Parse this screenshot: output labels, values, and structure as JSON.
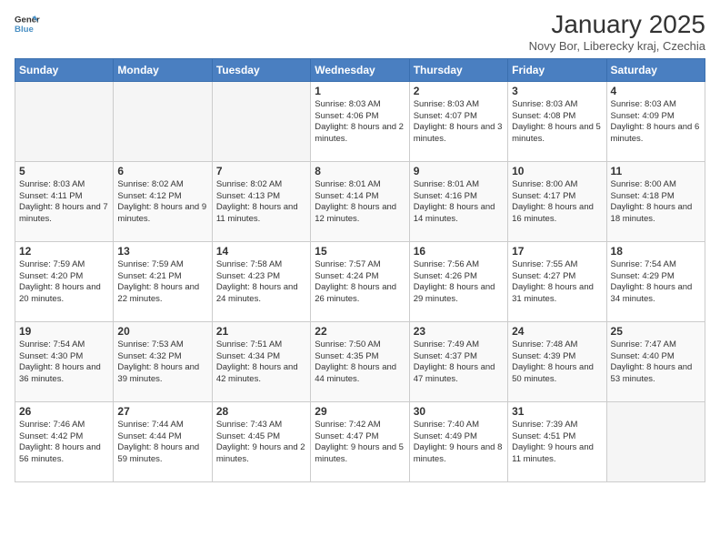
{
  "logo": {
    "line1": "General",
    "line2": "Blue"
  },
  "title": "January 2025",
  "location": "Novy Bor, Liberecky kraj, Czechia",
  "weekdays": [
    "Sunday",
    "Monday",
    "Tuesday",
    "Wednesday",
    "Thursday",
    "Friday",
    "Saturday"
  ],
  "weeks": [
    [
      {
        "day": "",
        "info": ""
      },
      {
        "day": "",
        "info": ""
      },
      {
        "day": "",
        "info": ""
      },
      {
        "day": "1",
        "info": "Sunrise: 8:03 AM\nSunset: 4:06 PM\nDaylight: 8 hours and 2 minutes."
      },
      {
        "day": "2",
        "info": "Sunrise: 8:03 AM\nSunset: 4:07 PM\nDaylight: 8 hours and 3 minutes."
      },
      {
        "day": "3",
        "info": "Sunrise: 8:03 AM\nSunset: 4:08 PM\nDaylight: 8 hours and 5 minutes."
      },
      {
        "day": "4",
        "info": "Sunrise: 8:03 AM\nSunset: 4:09 PM\nDaylight: 8 hours and 6 minutes."
      }
    ],
    [
      {
        "day": "5",
        "info": "Sunrise: 8:03 AM\nSunset: 4:11 PM\nDaylight: 8 hours and 7 minutes."
      },
      {
        "day": "6",
        "info": "Sunrise: 8:02 AM\nSunset: 4:12 PM\nDaylight: 8 hours and 9 minutes."
      },
      {
        "day": "7",
        "info": "Sunrise: 8:02 AM\nSunset: 4:13 PM\nDaylight: 8 hours and 11 minutes."
      },
      {
        "day": "8",
        "info": "Sunrise: 8:01 AM\nSunset: 4:14 PM\nDaylight: 8 hours and 12 minutes."
      },
      {
        "day": "9",
        "info": "Sunrise: 8:01 AM\nSunset: 4:16 PM\nDaylight: 8 hours and 14 minutes."
      },
      {
        "day": "10",
        "info": "Sunrise: 8:00 AM\nSunset: 4:17 PM\nDaylight: 8 hours and 16 minutes."
      },
      {
        "day": "11",
        "info": "Sunrise: 8:00 AM\nSunset: 4:18 PM\nDaylight: 8 hours and 18 minutes."
      }
    ],
    [
      {
        "day": "12",
        "info": "Sunrise: 7:59 AM\nSunset: 4:20 PM\nDaylight: 8 hours and 20 minutes."
      },
      {
        "day": "13",
        "info": "Sunrise: 7:59 AM\nSunset: 4:21 PM\nDaylight: 8 hours and 22 minutes."
      },
      {
        "day": "14",
        "info": "Sunrise: 7:58 AM\nSunset: 4:23 PM\nDaylight: 8 hours and 24 minutes."
      },
      {
        "day": "15",
        "info": "Sunrise: 7:57 AM\nSunset: 4:24 PM\nDaylight: 8 hours and 26 minutes."
      },
      {
        "day": "16",
        "info": "Sunrise: 7:56 AM\nSunset: 4:26 PM\nDaylight: 8 hours and 29 minutes."
      },
      {
        "day": "17",
        "info": "Sunrise: 7:55 AM\nSunset: 4:27 PM\nDaylight: 8 hours and 31 minutes."
      },
      {
        "day": "18",
        "info": "Sunrise: 7:54 AM\nSunset: 4:29 PM\nDaylight: 8 hours and 34 minutes."
      }
    ],
    [
      {
        "day": "19",
        "info": "Sunrise: 7:54 AM\nSunset: 4:30 PM\nDaylight: 8 hours and 36 minutes."
      },
      {
        "day": "20",
        "info": "Sunrise: 7:53 AM\nSunset: 4:32 PM\nDaylight: 8 hours and 39 minutes."
      },
      {
        "day": "21",
        "info": "Sunrise: 7:51 AM\nSunset: 4:34 PM\nDaylight: 8 hours and 42 minutes."
      },
      {
        "day": "22",
        "info": "Sunrise: 7:50 AM\nSunset: 4:35 PM\nDaylight: 8 hours and 44 minutes."
      },
      {
        "day": "23",
        "info": "Sunrise: 7:49 AM\nSunset: 4:37 PM\nDaylight: 8 hours and 47 minutes."
      },
      {
        "day": "24",
        "info": "Sunrise: 7:48 AM\nSunset: 4:39 PM\nDaylight: 8 hours and 50 minutes."
      },
      {
        "day": "25",
        "info": "Sunrise: 7:47 AM\nSunset: 4:40 PM\nDaylight: 8 hours and 53 minutes."
      }
    ],
    [
      {
        "day": "26",
        "info": "Sunrise: 7:46 AM\nSunset: 4:42 PM\nDaylight: 8 hours and 56 minutes."
      },
      {
        "day": "27",
        "info": "Sunrise: 7:44 AM\nSunset: 4:44 PM\nDaylight: 8 hours and 59 minutes."
      },
      {
        "day": "28",
        "info": "Sunrise: 7:43 AM\nSunset: 4:45 PM\nDaylight: 9 hours and 2 minutes."
      },
      {
        "day": "29",
        "info": "Sunrise: 7:42 AM\nSunset: 4:47 PM\nDaylight: 9 hours and 5 minutes."
      },
      {
        "day": "30",
        "info": "Sunrise: 7:40 AM\nSunset: 4:49 PM\nDaylight: 9 hours and 8 minutes."
      },
      {
        "day": "31",
        "info": "Sunrise: 7:39 AM\nSunset: 4:51 PM\nDaylight: 9 hours and 11 minutes."
      },
      {
        "day": "",
        "info": ""
      }
    ]
  ]
}
